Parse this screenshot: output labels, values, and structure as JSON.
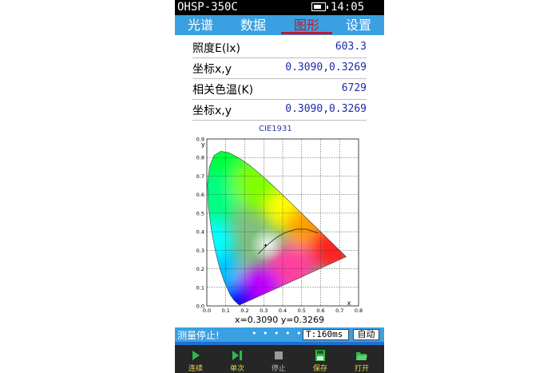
{
  "titlebar": {
    "app_name": "OHSP-350C",
    "time": "14:05",
    "battery_level": 0.75
  },
  "tabs": [
    {
      "label": "光谱",
      "active": false
    },
    {
      "label": "数据",
      "active": false
    },
    {
      "label": "图形",
      "active": true
    },
    {
      "label": "设置",
      "active": false
    }
  ],
  "readings": [
    {
      "label": "照度E(lx)",
      "value": "603.3"
    },
    {
      "label": "坐标x,y",
      "value": "0.3090,0.3269"
    },
    {
      "label": "相关色温(K)",
      "value": "6729"
    },
    {
      "label": "坐标x,y",
      "value": "0.3090,0.3269"
    }
  ],
  "chart_data": {
    "type": "scatter",
    "title": "CIE1931",
    "x_axis": {
      "label": "x",
      "range": [
        0,
        0.8
      ],
      "ticks": [
        "0.0",
        "0.1",
        "0.2",
        "0.3",
        "0.4",
        "0.5",
        "0.6",
        "0.7",
        "0.8"
      ]
    },
    "y_axis": {
      "label": "y",
      "range": [
        0,
        0.9
      ],
      "ticks": [
        "0.0",
        "0.1",
        "0.2",
        "0.3",
        "0.4",
        "0.5",
        "0.6",
        "0.7",
        "0.8",
        "0.9"
      ]
    },
    "grid": true,
    "point": {
      "x": 0.309,
      "y": 0.3269
    },
    "readout": "x=0.3090 y=0.3269",
    "locus": [
      [
        0.1741,
        0.005
      ],
      [
        0.1738,
        0.0049
      ],
      [
        0.1733,
        0.0048
      ],
      [
        0.1726,
        0.0048
      ],
      [
        0.1714,
        0.0051
      ],
      [
        0.1689,
        0.0069
      ],
      [
        0.1644,
        0.0109
      ],
      [
        0.1566,
        0.0177
      ],
      [
        0.144,
        0.0297
      ],
      [
        0.1241,
        0.0578
      ],
      [
        0.0913,
        0.1327
      ],
      [
        0.0687,
        0.2007
      ],
      [
        0.0454,
        0.295
      ],
      [
        0.0235,
        0.4127
      ],
      [
        0.0082,
        0.5384
      ],
      [
        0.0039,
        0.6548
      ],
      [
        0.0139,
        0.7502
      ],
      [
        0.0389,
        0.812
      ],
      [
        0.0743,
        0.8338
      ],
      [
        0.1142,
        0.8262
      ],
      [
        0.1547,
        0.8059
      ],
      [
        0.1929,
        0.7816
      ],
      [
        0.2296,
        0.7543
      ],
      [
        0.2658,
        0.7243
      ],
      [
        0.3016,
        0.6923
      ],
      [
        0.3373,
        0.6589
      ],
      [
        0.3731,
        0.6245
      ],
      [
        0.4087,
        0.5896
      ],
      [
        0.4441,
        0.5547
      ],
      [
        0.4788,
        0.5202
      ],
      [
        0.5125,
        0.4866
      ],
      [
        0.5448,
        0.4544
      ],
      [
        0.5752,
        0.4242
      ],
      [
        0.6029,
        0.3965
      ],
      [
        0.627,
        0.3725
      ],
      [
        0.6482,
        0.3514
      ],
      [
        0.6658,
        0.334
      ],
      [
        0.6801,
        0.3197
      ],
      [
        0.6915,
        0.3083
      ],
      [
        0.7006,
        0.2993
      ],
      [
        0.7079,
        0.292
      ],
      [
        0.714,
        0.2859
      ],
      [
        0.719,
        0.2809
      ],
      [
        0.723,
        0.277
      ],
      [
        0.726,
        0.274
      ],
      [
        0.7347,
        0.2653
      ]
    ],
    "planckian": [
      [
        0.5857,
        0.3931
      ],
      [
        0.5267,
        0.4133
      ],
      [
        0.4762,
        0.4137
      ],
      [
        0.4369,
        0.4041
      ],
      [
        0.4053,
        0.3907
      ],
      [
        0.3805,
        0.3768
      ],
      [
        0.3608,
        0.3636
      ],
      [
        0.3451,
        0.3516
      ],
      [
        0.3325,
        0.3411
      ],
      [
        0.3221,
        0.3318
      ],
      [
        0.3135,
        0.3236
      ],
      [
        0.2998,
        0.3103
      ],
      [
        0.2896,
        0.2998
      ],
      [
        0.2818,
        0.2916
      ],
      [
        0.2756,
        0.285
      ],
      [
        0.2706,
        0.2796
      ]
    ]
  },
  "status": {
    "text": "测量停止!",
    "page_dots": "• • • • • •",
    "interval": "T:160ms",
    "mode": "自动"
  },
  "bottom_buttons": [
    {
      "label": "连续",
      "icon": "play-icon",
      "enabled": true
    },
    {
      "label": "单次",
      "icon": "step-forward-icon",
      "enabled": true
    },
    {
      "label": "停止",
      "icon": "stop-icon",
      "enabled": false
    },
    {
      "label": "保存",
      "icon": "save-icon",
      "enabled": true
    },
    {
      "label": "打开",
      "icon": "folder-open-icon",
      "enabled": true
    }
  ],
  "colors": {
    "tab_bar": "#3aa0e2",
    "active_tab": "#c0182a",
    "value_text": "#1a2aa8",
    "button_label": "#e8d84a",
    "button_bar": "#262626"
  }
}
